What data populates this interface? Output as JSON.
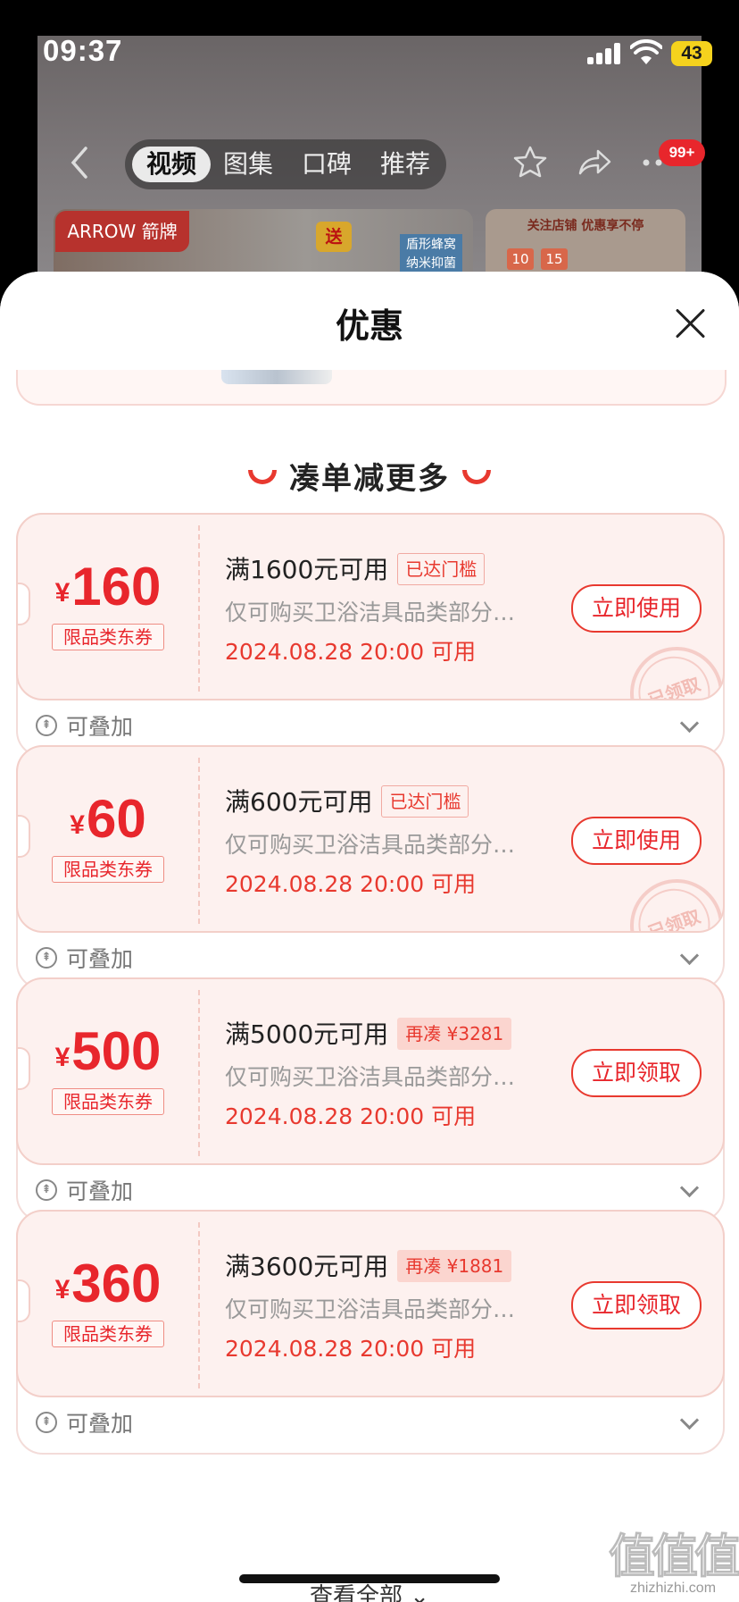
{
  "status_bar": {
    "time": "09:37",
    "battery": "43"
  },
  "background_page": {
    "tabs": [
      {
        "label": "视频",
        "active": true
      },
      {
        "label": "图集",
        "active": false
      },
      {
        "label": "口碑",
        "active": false
      },
      {
        "label": "推荐",
        "active": false
      }
    ],
    "message_badge": "99+",
    "brand_tag": "ARROW 箭牌",
    "gift_tag": "送",
    "product_tag": "盾形蜂窝\n纳米抑菌",
    "right_banner_title": "关注店铺 优惠享不停",
    "right_banner_values": [
      "10",
      "15"
    ]
  },
  "sheet": {
    "title": "优惠",
    "section_title": "凑单减更多",
    "coupons": [
      {
        "currency": "¥",
        "amount": "160",
        "type": "限品类东券",
        "condition": "满1600元可用",
        "tag": "已达门槛",
        "tag_style": "outline",
        "description": "仅可购买卫浴洁具品类部分…",
        "date": "2024.08.28 20:00 可用",
        "action": "立即使用",
        "stamp": "已领取",
        "stack_label": "可叠加"
      },
      {
        "currency": "¥",
        "amount": "60",
        "type": "限品类东券",
        "condition": "满600元可用",
        "tag": "已达门槛",
        "tag_style": "outline",
        "description": "仅可购买卫浴洁具品类部分…",
        "date": "2024.08.28 20:00 可用",
        "action": "立即使用",
        "stamp": "已领取",
        "stack_label": "可叠加"
      },
      {
        "currency": "¥",
        "amount": "500",
        "type": "限品类东券",
        "condition": "满5000元可用",
        "tag": "再凑 ¥3281",
        "tag_style": "fill",
        "description": "仅可购买卫浴洁具品类部分…",
        "date": "2024.08.28 20:00 可用",
        "action": "立即领取",
        "stamp": "",
        "stack_label": "可叠加"
      },
      {
        "currency": "¥",
        "amount": "360",
        "type": "限品类东券",
        "condition": "满3600元可用",
        "tag": "再凑 ¥1881",
        "tag_style": "fill",
        "description": "仅可购买卫浴洁具品类部分…",
        "date": "2024.08.28 20:00 可用",
        "action": "立即领取",
        "stamp": "",
        "stack_label": "可叠加"
      }
    ],
    "view_all": "查看全部"
  },
  "watermark": {
    "logo": "值值值",
    "site": "zhizhizhi.com"
  },
  "colors": {
    "accent": "#e8262c",
    "coupon_bg": "#fdf1ef"
  }
}
